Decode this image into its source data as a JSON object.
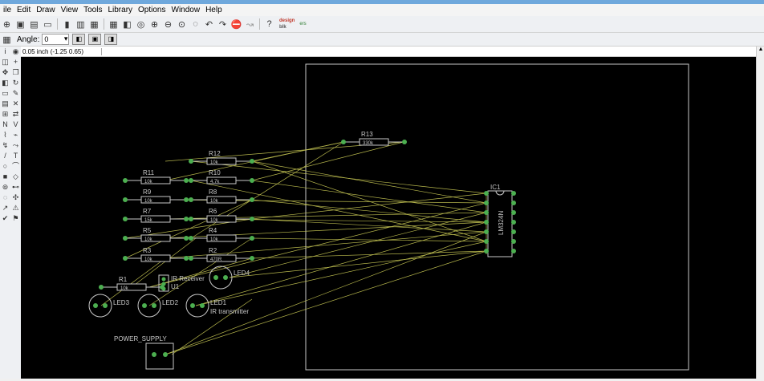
{
  "menu": [
    "ile",
    "Edit",
    "Draw",
    "View",
    "Tools",
    "Library",
    "Options",
    "Window",
    "Help"
  ],
  "toolbar": {
    "icons": [
      "open-icon",
      "save-icon",
      "print-icon",
      "cam-icon",
      "separator",
      "script-icon",
      "board-icon",
      "run-icon",
      "separator",
      "grid-icon",
      "layers-icon",
      "zoom-fit-icon",
      "zoom-in-icon",
      "zoom-out-icon",
      "zoom-redraw-icon",
      "zoom-select-icon",
      "undo-icon",
      "redo-icon",
      "stop-icon",
      "go-icon",
      "separator",
      "help-icon"
    ],
    "brand_top": "design",
    "brand_mid": "blk",
    "brand_right": "ers"
  },
  "params": {
    "angle_label": "Angle:",
    "angle_value": "0"
  },
  "status": {
    "coordinate": "0.05 inch (-1.25 0.65)",
    "command": ""
  },
  "colors": {
    "canvas": "#000000",
    "pad": "#4caf50",
    "airwire": "#d6d65a",
    "outline": "#c8c8c8"
  },
  "schematic": {
    "resistors": [
      {
        "name": "R12",
        "value": "10k"
      },
      {
        "name": "R11",
        "value": "10k"
      },
      {
        "name": "R10",
        "value": "4.7k"
      },
      {
        "name": "R9",
        "value": "10k"
      },
      {
        "name": "R8",
        "value": "10k"
      },
      {
        "name": "R7",
        "value": "15k"
      },
      {
        "name": "R6",
        "value": "10k"
      },
      {
        "name": "R5",
        "value": "10k"
      },
      {
        "name": "R4",
        "value": "10k"
      },
      {
        "name": "R3",
        "value": "10k"
      },
      {
        "name": "R2",
        "value": "470R"
      },
      {
        "name": "R1",
        "value": "10k"
      },
      {
        "name": "R13",
        "value": "330k"
      }
    ],
    "leds": [
      {
        "name": "LED3"
      },
      {
        "name": "LED2"
      },
      {
        "name": "LED1",
        "note": "IR transmitter"
      },
      {
        "name": "LED4"
      }
    ],
    "ir_receiver": {
      "name": "IR Receiver",
      "ref": "U1"
    },
    "ic": {
      "name": "IC1",
      "part": "LM324N"
    },
    "power": {
      "name": "POWER_SUPPLY"
    }
  }
}
